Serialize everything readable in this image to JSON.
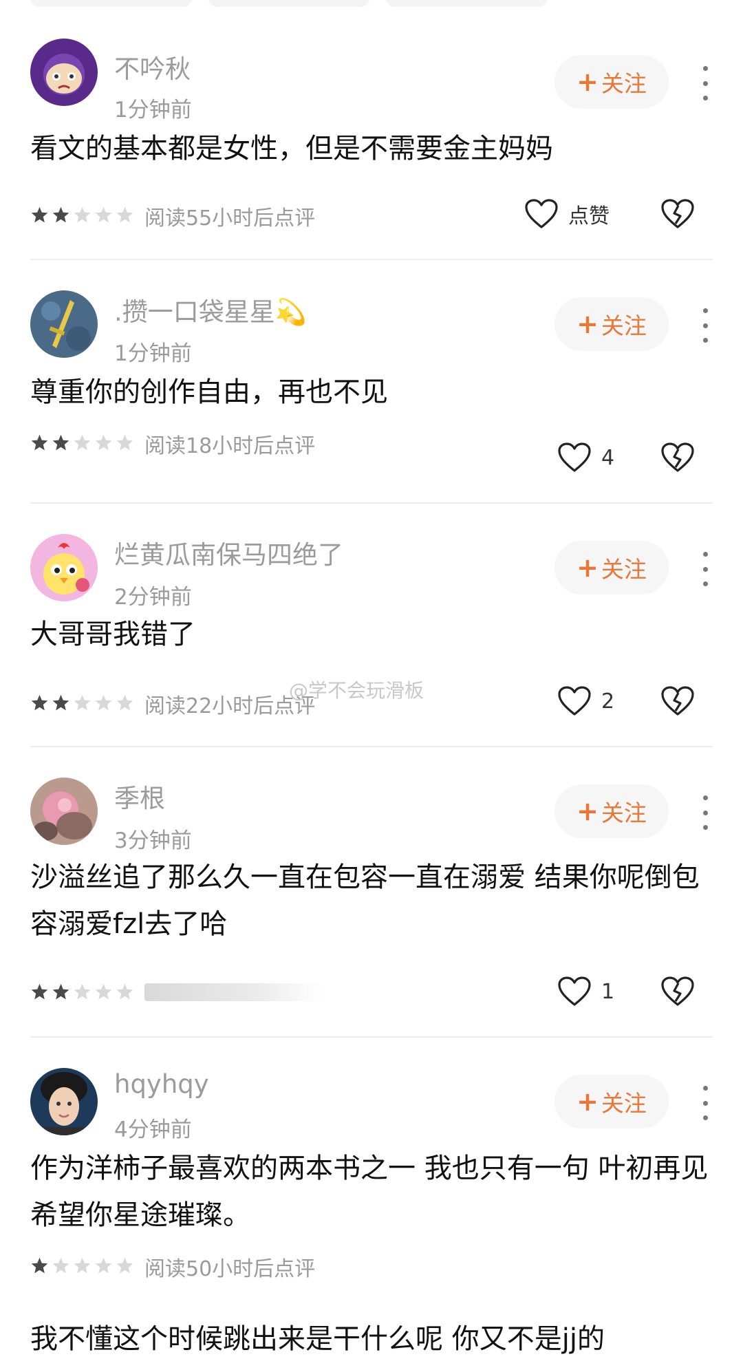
{
  "watermark": "@学不会玩滑板",
  "follow_label": "关注",
  "comments": [
    {
      "username": "不吟秋",
      "time": "1分钟前",
      "text": "看文的基本都是女性，但是不需要金主妈妈",
      "rating": 2,
      "meta": "阅读55小时后点评",
      "like_label": "点赞",
      "avatar": "purple-cartoon-face"
    },
    {
      "username": ".攒一口袋星星💫",
      "time": "1分钟前",
      "text": "尊重你的创作自由，再也不见",
      "rating": 2,
      "meta": "阅读18小时后点评",
      "like_count": "4",
      "avatar": "sword-on-blue"
    },
    {
      "username": "烂黄瓜南保马四绝了",
      "time": "2分钟前",
      "text": "大哥哥我错了",
      "rating": 2,
      "meta": "阅读22小时后点评",
      "like_count": "2",
      "avatar": "yellow-chick-cartoon"
    },
    {
      "username": "季根",
      "time": "3分钟前",
      "text": "沙溢丝追了那么久一直在包容一直在溺爱 结果你呢倒包容溺爱fzl去了哈",
      "rating": 2,
      "meta": "",
      "like_count": "1",
      "avatar": "photo-pink"
    },
    {
      "username": "hqyhqy",
      "time": "4分钟前",
      "text": "作为洋柿子最喜欢的两本书之一 我也只有一句 叶初再见 希望你星途璀璨。",
      "rating": 1,
      "meta": "阅读50小时后点评",
      "avatar": "photo-man"
    }
  ],
  "partial_comment": {
    "text": "我不懂这个时候跳出来是干什么呢 你又不是jj的"
  },
  "colors": {
    "accent": "#e8783a",
    "star_filled": "#4a4a4a",
    "star_empty": "#d8d8d8"
  }
}
